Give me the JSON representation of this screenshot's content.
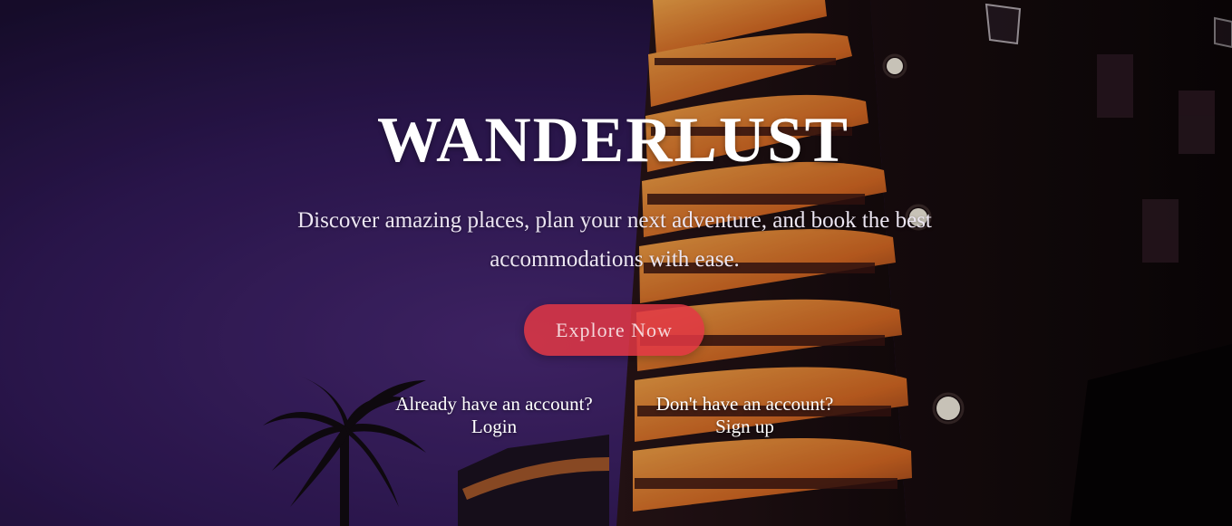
{
  "hero": {
    "title": "WANDERLUST",
    "subtitle": "Discover amazing places, plan your next adventure, and book the best accommodations with ease.",
    "cta_label": "Explore Now"
  },
  "accounts": {
    "login_prompt": "Already have an account?",
    "login_label": "Login",
    "signup_prompt": "Don't have an account?",
    "signup_label": "Sign up"
  },
  "colors": {
    "sky": "#3a2466",
    "building_glow": "#e8892e",
    "cta": "#e23744",
    "text": "#ffffff"
  }
}
